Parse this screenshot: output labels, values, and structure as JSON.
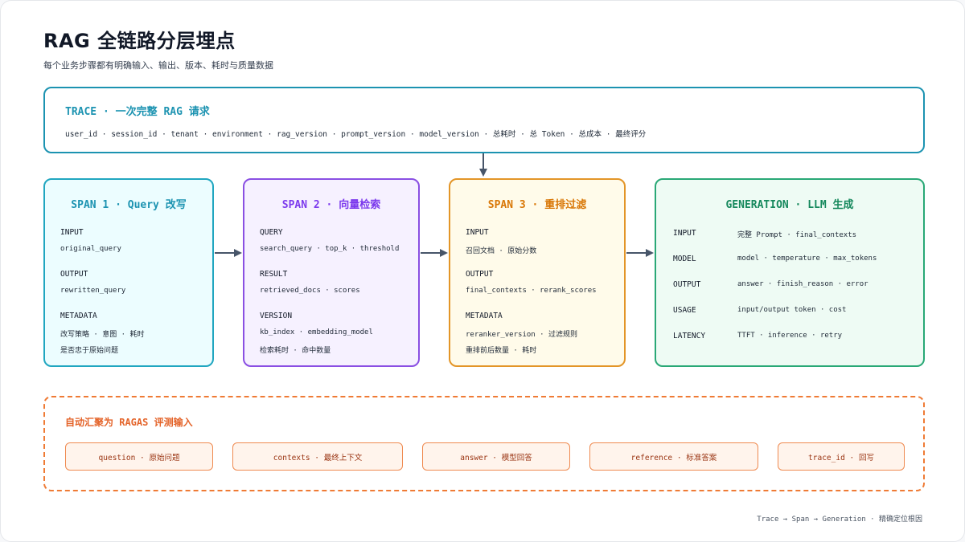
{
  "header": {
    "title": "RAG 全链路分层埋点",
    "subtitle": "每个业务步骤都有明确输入、输出、版本、耗时与质量数据"
  },
  "trace": {
    "title": "TRACE · 一次完整 RAG 请求",
    "fields": "user_id · session_id · tenant · environment · rag_version · prompt_version · model_version · 总耗时 · 总 Token · 总成本 · 最终评分"
  },
  "spans": [
    {
      "title": "SPAN 1 · Query 改写",
      "sections": [
        {
          "label": "INPUT",
          "lines": [
            "original_query"
          ]
        },
        {
          "label": "OUTPUT",
          "lines": [
            "rewritten_query"
          ]
        },
        {
          "label": "METADATA",
          "lines": [
            "改写策略 · 意图 · 耗时",
            "是否忠于原始问题"
          ]
        }
      ]
    },
    {
      "title": "SPAN 2 · 向量检索",
      "sections": [
        {
          "label": "QUERY",
          "lines": [
            "search_query · top_k · threshold"
          ]
        },
        {
          "label": "RESULT",
          "lines": [
            "retrieved_docs · scores"
          ]
        },
        {
          "label": "VERSION",
          "lines": [
            "kb_index · embedding_model",
            "检索耗时 · 命中数量"
          ]
        }
      ]
    },
    {
      "title": "SPAN 3 · 重排过滤",
      "sections": [
        {
          "label": "INPUT",
          "lines": [
            "召回文档 · 原始分数"
          ]
        },
        {
          "label": "OUTPUT",
          "lines": [
            "final_contexts · rerank_scores"
          ]
        },
        {
          "label": "METADATA",
          "lines": [
            "reranker_version · 过滤规则",
            "重排前后数量 · 耗时"
          ]
        }
      ]
    }
  ],
  "generation": {
    "title": "GENERATION · LLM 生成",
    "rows": [
      {
        "label": "INPUT",
        "value": "完整 Prompt · final_contexts"
      },
      {
        "label": "MODEL",
        "value": "model · temperature · max_tokens"
      },
      {
        "label": "OUTPUT",
        "value": "answer · finish_reason · error"
      },
      {
        "label": "USAGE",
        "value": "input/output token · cost"
      },
      {
        "label": "LATENCY",
        "value": "TTFT · inference · retry"
      }
    ]
  },
  "ragas": {
    "title": "自动汇聚为 RAGAS 评测输入",
    "chips": [
      "question · 原始问题",
      "contexts · 最终上下文",
      "answer · 模型回答",
      "reference · 标准答案",
      "trace_id · 回写"
    ]
  },
  "footer": "Trace → Span → Generation · 精确定位根因",
  "colors": {
    "trace": "#1c93b1",
    "span1": "#20a6c0",
    "span2": "#8a4fe3",
    "span3": "#e39527",
    "generation": "#29a876",
    "ragas": "#ef7b35",
    "arrow": "#475569"
  }
}
